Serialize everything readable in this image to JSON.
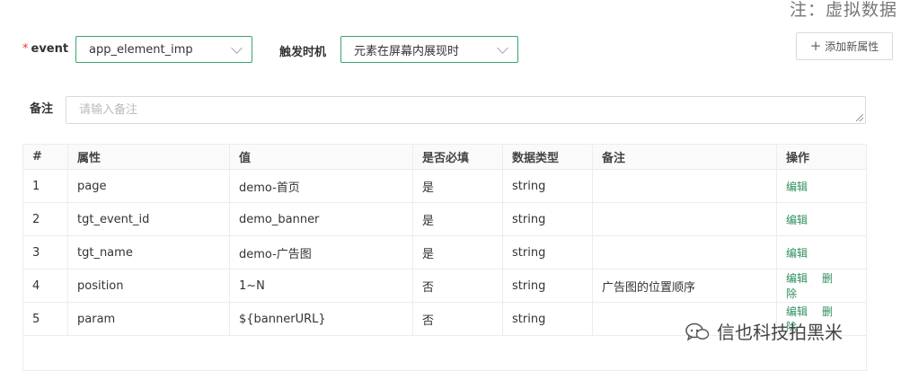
{
  "top_note": "注：虚拟数据",
  "form": {
    "event_label": "event",
    "event_required_mark": "*",
    "event_value": "app_element_imp",
    "trigger_label": "触发时机",
    "trigger_value": "元素在屏幕内展现时",
    "add_button_label": "添加新属性",
    "remark_label": "备注",
    "remark_placeholder": "请输入备注"
  },
  "table": {
    "headers": [
      "#",
      "属性",
      "值",
      "是否必填",
      "数据类型",
      "备注",
      "操作"
    ],
    "rows": [
      {
        "idx": "1",
        "attr": "page",
        "value": "demo-首页",
        "required": "是",
        "type": "string",
        "note": "",
        "edit": "编辑",
        "delete": ""
      },
      {
        "idx": "2",
        "attr": "tgt_event_id",
        "value": "demo_banner",
        "required": "是",
        "type": "string",
        "note": "",
        "edit": "编辑",
        "delete": ""
      },
      {
        "idx": "3",
        "attr": "tgt_name",
        "value": "demo-广告图",
        "required": "是",
        "type": "string",
        "note": "",
        "edit": "编辑",
        "delete": ""
      },
      {
        "idx": "4",
        "attr": "position",
        "value": "1~N",
        "required": "否",
        "type": "string",
        "note": "广告图的位置顺序",
        "edit": "编辑",
        "delete": "删除"
      },
      {
        "idx": "5",
        "attr": "param",
        "value": "${bannerURL}",
        "required": "否",
        "type": "string",
        "note": "",
        "edit": "编辑",
        "delete": "删除"
      }
    ]
  },
  "watermark": "信也科技拍黑米"
}
